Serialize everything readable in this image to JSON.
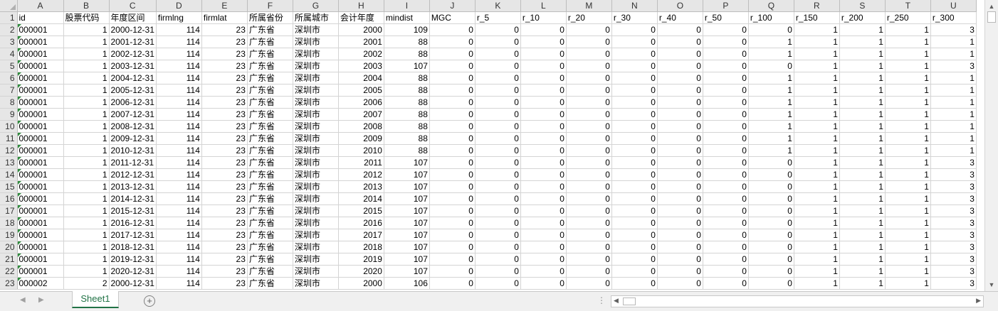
{
  "columns": [
    "A",
    "B",
    "C",
    "D",
    "E",
    "F",
    "G",
    "H",
    "I",
    "J",
    "K",
    "L",
    "M",
    "N",
    "O",
    "P",
    "Q",
    "R",
    "S",
    "T",
    "U"
  ],
  "header_row": [
    "id",
    "股票代码",
    "年度区间",
    "firmlng",
    "firmlat",
    "所属省份",
    "所属城市",
    "会计年度",
    "mindist",
    "MGC",
    "r_5",
    "r_10",
    "r_20",
    "r_30",
    "r_40",
    "r_50",
    "r_100",
    "r_150",
    "r_200",
    "r_250",
    "r_300"
  ],
  "rows": [
    [
      "000001",
      "1",
      "2000-12-31",
      "114",
      "23",
      "广东省",
      "深圳市",
      "2000",
      "109",
      "0",
      "0",
      "0",
      "0",
      "0",
      "0",
      "0",
      "0",
      "1",
      "1",
      "1",
      "3"
    ],
    [
      "000001",
      "1",
      "2001-12-31",
      "114",
      "23",
      "广东省",
      "深圳市",
      "2001",
      "88",
      "0",
      "0",
      "0",
      "0",
      "0",
      "0",
      "0",
      "1",
      "1",
      "1",
      "1",
      "1"
    ],
    [
      "000001",
      "1",
      "2002-12-31",
      "114",
      "23",
      "广东省",
      "深圳市",
      "2002",
      "88",
      "0",
      "0",
      "0",
      "0",
      "0",
      "0",
      "0",
      "1",
      "1",
      "1",
      "1",
      "1"
    ],
    [
      "000001",
      "1",
      "2003-12-31",
      "114",
      "23",
      "广东省",
      "深圳市",
      "2003",
      "107",
      "0",
      "0",
      "0",
      "0",
      "0",
      "0",
      "0",
      "0",
      "1",
      "1",
      "1",
      "3"
    ],
    [
      "000001",
      "1",
      "2004-12-31",
      "114",
      "23",
      "广东省",
      "深圳市",
      "2004",
      "88",
      "0",
      "0",
      "0",
      "0",
      "0",
      "0",
      "0",
      "1",
      "1",
      "1",
      "1",
      "1"
    ],
    [
      "000001",
      "1",
      "2005-12-31",
      "114",
      "23",
      "广东省",
      "深圳市",
      "2005",
      "88",
      "0",
      "0",
      "0",
      "0",
      "0",
      "0",
      "0",
      "1",
      "1",
      "1",
      "1",
      "1"
    ],
    [
      "000001",
      "1",
      "2006-12-31",
      "114",
      "23",
      "广东省",
      "深圳市",
      "2006",
      "88",
      "0",
      "0",
      "0",
      "0",
      "0",
      "0",
      "0",
      "1",
      "1",
      "1",
      "1",
      "1"
    ],
    [
      "000001",
      "1",
      "2007-12-31",
      "114",
      "23",
      "广东省",
      "深圳市",
      "2007",
      "88",
      "0",
      "0",
      "0",
      "0",
      "0",
      "0",
      "0",
      "1",
      "1",
      "1",
      "1",
      "1"
    ],
    [
      "000001",
      "1",
      "2008-12-31",
      "114",
      "23",
      "广东省",
      "深圳市",
      "2008",
      "88",
      "0",
      "0",
      "0",
      "0",
      "0",
      "0",
      "0",
      "1",
      "1",
      "1",
      "1",
      "1"
    ],
    [
      "000001",
      "1",
      "2009-12-31",
      "114",
      "23",
      "广东省",
      "深圳市",
      "2009",
      "88",
      "0",
      "0",
      "0",
      "0",
      "0",
      "0",
      "0",
      "1",
      "1",
      "1",
      "1",
      "1"
    ],
    [
      "000001",
      "1",
      "2010-12-31",
      "114",
      "23",
      "广东省",
      "深圳市",
      "2010",
      "88",
      "0",
      "0",
      "0",
      "0",
      "0",
      "0",
      "0",
      "1",
      "1",
      "1",
      "1",
      "1"
    ],
    [
      "000001",
      "1",
      "2011-12-31",
      "114",
      "23",
      "广东省",
      "深圳市",
      "2011",
      "107",
      "0",
      "0",
      "0",
      "0",
      "0",
      "0",
      "0",
      "0",
      "1",
      "1",
      "1",
      "3"
    ],
    [
      "000001",
      "1",
      "2012-12-31",
      "114",
      "23",
      "广东省",
      "深圳市",
      "2012",
      "107",
      "0",
      "0",
      "0",
      "0",
      "0",
      "0",
      "0",
      "0",
      "1",
      "1",
      "1",
      "3"
    ],
    [
      "000001",
      "1",
      "2013-12-31",
      "114",
      "23",
      "广东省",
      "深圳市",
      "2013",
      "107",
      "0",
      "0",
      "0",
      "0",
      "0",
      "0",
      "0",
      "0",
      "1",
      "1",
      "1",
      "3"
    ],
    [
      "000001",
      "1",
      "2014-12-31",
      "114",
      "23",
      "广东省",
      "深圳市",
      "2014",
      "107",
      "0",
      "0",
      "0",
      "0",
      "0",
      "0",
      "0",
      "0",
      "1",
      "1",
      "1",
      "3"
    ],
    [
      "000001",
      "1",
      "2015-12-31",
      "114",
      "23",
      "广东省",
      "深圳市",
      "2015",
      "107",
      "0",
      "0",
      "0",
      "0",
      "0",
      "0",
      "0",
      "0",
      "1",
      "1",
      "1",
      "3"
    ],
    [
      "000001",
      "1",
      "2016-12-31",
      "114",
      "23",
      "广东省",
      "深圳市",
      "2016",
      "107",
      "0",
      "0",
      "0",
      "0",
      "0",
      "0",
      "0",
      "0",
      "1",
      "1",
      "1",
      "3"
    ],
    [
      "000001",
      "1",
      "2017-12-31",
      "114",
      "23",
      "广东省",
      "深圳市",
      "2017",
      "107",
      "0",
      "0",
      "0",
      "0",
      "0",
      "0",
      "0",
      "0",
      "1",
      "1",
      "1",
      "3"
    ],
    [
      "000001",
      "1",
      "2018-12-31",
      "114",
      "23",
      "广东省",
      "深圳市",
      "2018",
      "107",
      "0",
      "0",
      "0",
      "0",
      "0",
      "0",
      "0",
      "0",
      "1",
      "1",
      "1",
      "3"
    ],
    [
      "000001",
      "1",
      "2019-12-31",
      "114",
      "23",
      "广东省",
      "深圳市",
      "2019",
      "107",
      "0",
      "0",
      "0",
      "0",
      "0",
      "0",
      "0",
      "0",
      "1",
      "1",
      "1",
      "3"
    ],
    [
      "000001",
      "1",
      "2020-12-31",
      "114",
      "23",
      "广东省",
      "深圳市",
      "2020",
      "107",
      "0",
      "0",
      "0",
      "0",
      "0",
      "0",
      "0",
      "0",
      "1",
      "1",
      "1",
      "3"
    ],
    [
      "000002",
      "2",
      "2000-12-31",
      "114",
      "23",
      "广东省",
      "深圳市",
      "2000",
      "106",
      "0",
      "0",
      "0",
      "0",
      "0",
      "0",
      "0",
      "0",
      "1",
      "1",
      "1",
      "3"
    ]
  ],
  "numeric_columns": [
    1,
    3,
    4,
    7,
    8,
    9,
    10,
    11,
    12,
    13,
    14,
    15,
    16,
    17,
    18,
    19,
    20
  ],
  "sheet_tab": "Sheet1",
  "add_sheet_icon": "plus-circle-icon",
  "colors": {
    "accent": "#217346",
    "header_bg": "#e6e6e6",
    "grid": "#d4d4d4",
    "text_flag": "#2e8b3c"
  }
}
